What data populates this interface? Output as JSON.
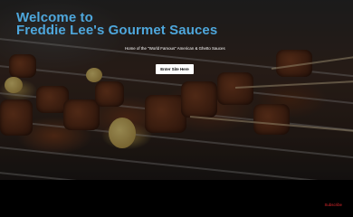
{
  "hero": {
    "title_line1": "Welcome to",
    "title_line2": "Freddie Lee's Gourmet Sauces",
    "tagline": "Home of the \"World Famous\" American & Ghetto Sauces",
    "enter_button_label": "Enter Site Here"
  },
  "footer": {
    "subscribe_label": "Subscribe"
  },
  "colors": {
    "title": "#4ea7dc",
    "subscribe": "#e0282d"
  }
}
